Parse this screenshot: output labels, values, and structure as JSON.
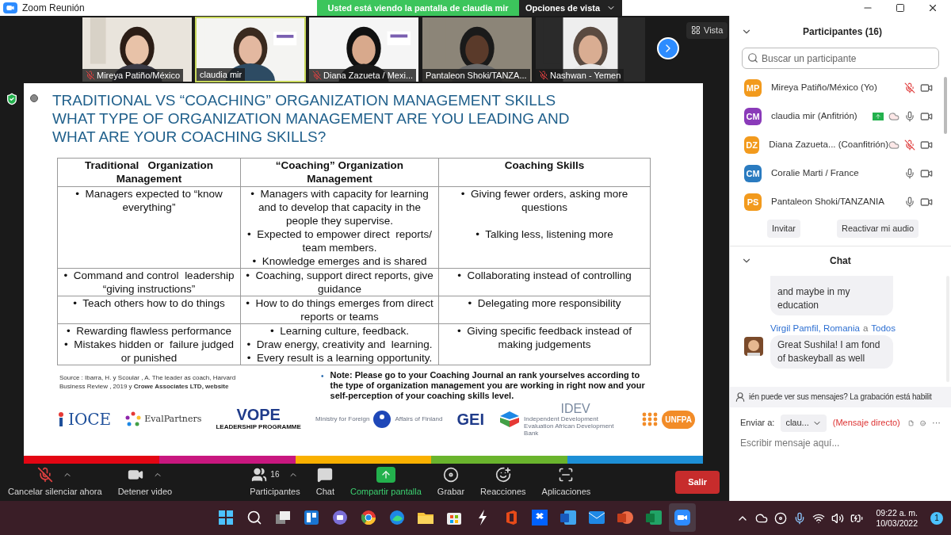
{
  "window": {
    "title": "Zoom Reunión"
  },
  "share_banner": {
    "text": "Usted está viendo la pantalla de claudia mir",
    "view_options": "Opciones de vista"
  },
  "videos": [
    {
      "name": "Mireya Patiño/México",
      "muted": true,
      "speaking": false
    },
    {
      "name": "claudia mir",
      "muted": false,
      "speaking": true
    },
    {
      "name": "Diana Zazueta / Mexi...",
      "muted": true,
      "speaking": false
    },
    {
      "name": "Pantaleon Shoki/TANZA...",
      "muted": false,
      "speaking": false
    },
    {
      "name": "Nashwan - Yemen",
      "muted": true,
      "speaking": false
    }
  ],
  "view_button": "Vista",
  "slide": {
    "title": [
      "TRADITIONAL VS “COACHING” ORGANIZATION MANAGEMENT SKILLS",
      "WHAT TYPE OF ORGANIZATION MANAGEMENT ARE YOU LEADING AND",
      "WHAT ARE YOUR COACHING SKILLS?"
    ],
    "table": {
      "columns": [
        "Traditional   Organization Management",
        "“Coaching” Organization Management",
        "Coaching Skills"
      ],
      "rows": [
        [
          [
            "•  Managers expected to “know everything”"
          ],
          [
            "•  Managers with capacity for learning and to develop that capacity in the people they supervise.",
            "•  Expected to empower direct  reports/ team members.",
            "•  Knowledge emerges and is shared"
          ],
          [
            "•  Giving fewer orders, asking more questions",
            "•  Talking less, listening more"
          ]
        ],
        [
          [
            "•  Command and control  leadership “giving instructions”"
          ],
          [
            "•  Coaching, support direct reports, give guidance"
          ],
          [
            "•  Collaborating instead of controlling"
          ]
        ],
        [
          [
            "•  Teach others how to do things"
          ],
          [
            "•  How to do things emerges from direct reports or teams"
          ],
          [
            "•  Delegating more responsibility"
          ]
        ],
        [
          [
            "•  Rewarding flawless performance",
            "•  Mistakes hidden or  failure judged or punished"
          ],
          [
            "•  Learning culture, feedback.",
            "•  Draw energy, creativity and  learning.",
            "•  Every result is a learning opportunity."
          ],
          [
            "•  Giving specific feedback instead of making judgements"
          ]
        ]
      ]
    },
    "source": "Source : Ibarra, H. y Scoular , A. The leader as coach, Harvard Business Review , 2019 y **Crowe Associates LTD, website**",
    "note_bullet": "•",
    "note": "Note: Please go to your Coaching Journal an rank yourselves according to the type of organization management you are working in right now and your self-perception of your coaching skills level.",
    "logos": [
      {
        "kind": "ioce",
        "text": "IOCE"
      },
      {
        "kind": "evalpartners",
        "text": "EvalPartners"
      },
      {
        "kind": "vope",
        "text": "VOPE",
        "sub": "LEADERSHIP PROGRAMME"
      },
      {
        "kind": "finland",
        "text": "Ministry for Foreign",
        "sub": "Affairs of Finland"
      },
      {
        "kind": "gei",
        "text": "GEI"
      },
      {
        "kind": "idev",
        "text": "IDEV",
        "sub": "Independent Development Evaluation African Development Bank"
      },
      {
        "kind": "unfpa",
        "text": "UNFPA"
      }
    ]
  },
  "toolbar": [
    {
      "kind": "mute",
      "label": "Cancelar silenciar ahora",
      "caret": true
    },
    {
      "kind": "video",
      "label": "Detener video",
      "caret": true
    },
    {
      "kind": "participants",
      "label": "Participantes",
      "count": "16",
      "caret": true
    },
    {
      "kind": "chat",
      "label": "Chat",
      "caret": false
    },
    {
      "kind": "share",
      "label": "Compartir pantalla",
      "caret": false
    },
    {
      "kind": "record",
      "label": "Grabar",
      "caret": false
    },
    {
      "kind": "reactions",
      "label": "Reacciones",
      "caret": false
    },
    {
      "kind": "apps",
      "label": "Aplicaciones",
      "caret": false
    }
  ],
  "leave_button": "Salir",
  "participants_panel": {
    "title": "Participantes (16)",
    "search_placeholder": "Buscar un participante",
    "participants": [
      {
        "initials": "MP",
        "color": "#f29a1d",
        "name": "Mireya Patiño/México (Yo)",
        "sharing": false,
        "recording": false,
        "muted": true
      },
      {
        "initials": "CM",
        "color": "#8a3ab9",
        "name": "claudia mir (Anfitrión)",
        "sharing": true,
        "recording": true,
        "muted": false
      },
      {
        "initials": "DZ",
        "color": "#f29a1d",
        "name": "Diana Zazueta... (Coanfitrión)",
        "sharing": false,
        "recording": true,
        "muted": true
      },
      {
        "initials": "CM",
        "color": "#2a7bc0",
        "name": "Coralie Marti / France",
        "sharing": false,
        "recording": false,
        "muted": false
      },
      {
        "initials": "PS",
        "color": "#f29a1d",
        "name": "Pantaleon Shoki/TANZANIA",
        "sharing": false,
        "recording": false,
        "muted": false
      }
    ],
    "buttons": [
      "Invitar",
      "Reactivar mi audio"
    ]
  },
  "chat": {
    "title": "Chat",
    "messages": [
      {
        "text": "and maybe in my education"
      },
      {
        "sender": "Virgil Pamfil, Romania",
        "to_word": "a",
        "recipient": "Todos",
        "text": "Great Sushila! I am fond of baskeyball as well"
      }
    ],
    "notice": "ién puede ver sus mensajes? La grabación está habilit",
    "send_to_label": "Enviar a:",
    "send_to_value": "clau...",
    "direct_tag": "(Mensaje directo)",
    "more": "···",
    "input_placeholder": "Escribir mensaje aquí..."
  },
  "taskbar": {
    "time": "09:22 a. m.",
    "date": "10/03/2022",
    "notifications": "1"
  }
}
